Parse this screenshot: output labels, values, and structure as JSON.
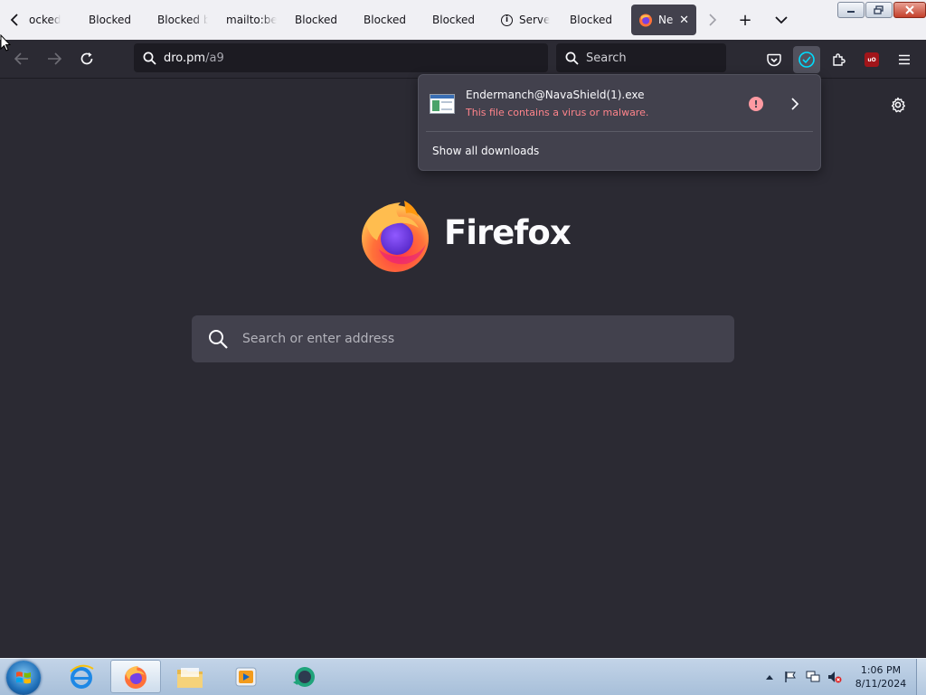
{
  "browser": {
    "tabs": [
      {
        "label": "ocked",
        "icon": "none"
      },
      {
        "label": "Blocked",
        "icon": "none"
      },
      {
        "label": "Blocked b",
        "icon": "none"
      },
      {
        "label": "mailto:bet",
        "icon": "none"
      },
      {
        "label": "Blocked",
        "icon": "none"
      },
      {
        "label": "Blocked",
        "icon": "none"
      },
      {
        "label": "Blocked",
        "icon": "none"
      },
      {
        "label": "Serve",
        "icon": "info-icon"
      },
      {
        "label": "Blocked",
        "icon": "none"
      },
      {
        "label": "Ne",
        "icon": "firefox-icon",
        "active": true
      }
    ],
    "tab_close_glyph": "✕",
    "new_tab_glyph": "+",
    "tab_list_glyph": "⌄",
    "url": {
      "host": "dro.pm",
      "path": "/a9"
    },
    "search_placeholder": "Search"
  },
  "downloads_panel": {
    "file_name": "Endermanch@NavaShield(1).exe",
    "status": "This file contains a virus or malware.",
    "warning_glyph": "!",
    "show_all_label": "Show all downloads"
  },
  "newtab": {
    "wordmark": "Firefox",
    "search_placeholder": "Search or enter address"
  },
  "taskbar": {
    "time": "1:06 PM",
    "date": "8/11/2024"
  },
  "colors": {
    "page_bg": "#2b2a33",
    "tabstrip_bg": "#f0f0f4",
    "panel_bg": "#42414d",
    "danger_text": "#ff848b",
    "accent": "#00ddff"
  }
}
